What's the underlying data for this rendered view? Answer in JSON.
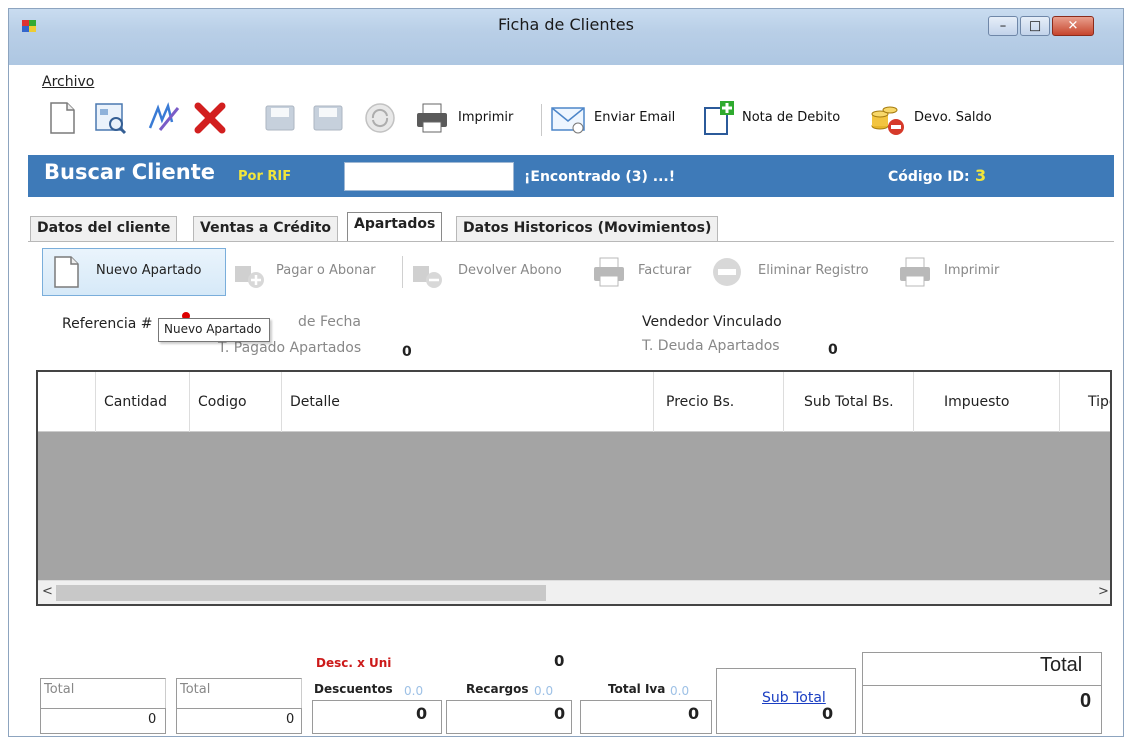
{
  "window": {
    "title": "Ficha de Clientes",
    "min_glyph": "–",
    "max_glyph": "□",
    "close_glyph": "✕"
  },
  "menu": {
    "archivo": "Archivo"
  },
  "toolbar": {
    "imprimir": "Imprimir",
    "enviar_email": "Enviar Email",
    "nota_debito": "Nota de Debito",
    "devo_saldo": "Devo. Saldo"
  },
  "search": {
    "title": "Buscar Cliente",
    "mode": "Por RIF",
    "input_value": "",
    "found": "¡Encontrado (3) ...!",
    "code_label": "Código ID:",
    "code_value": "3"
  },
  "tabs": [
    {
      "label": "Datos del cliente"
    },
    {
      "label": "Ventas a Crédito"
    },
    {
      "label": "Apartados"
    },
    {
      "label": "Datos Historicos (Movimientos)"
    }
  ],
  "subtoolbar": {
    "nuevo_apartado": "Nuevo Apartado",
    "pagar_abonar": "Pagar o Abonar",
    "devolver_abono": "Devolver Abono",
    "facturar": "Facturar",
    "eliminar_registro": "Eliminar Registro",
    "imprimir": "Imprimir"
  },
  "info": {
    "referencia": "Referencia #",
    "de_fecha": "de Fecha",
    "t_pagado": "T. Pagado Apartados",
    "t_pagado_val": "0",
    "vendedor": "Vendedor Vinculado",
    "t_deuda": "T. Deuda Apartados",
    "t_deuda_val": "0",
    "tooltip": "Nuevo Apartado"
  },
  "grid": {
    "columns": [
      "Cantidad",
      "Codigo",
      "Detalle",
      "Precio Bs.",
      "Sub Total Bs.",
      "Impuesto",
      "Tipo"
    ]
  },
  "totals": {
    "desc_x_uni": "Desc. x Uni",
    "desc_x_uni_val": "0",
    "total_label_1": "Total",
    "total_label_2": "Total",
    "descuentos": "Descuentos",
    "descuentos_hint": "0.0",
    "recargos": "Recargos",
    "recargos_hint": "0.0",
    "total_iva": "Total Iva",
    "total_iva_hint": "0.0",
    "sub_total": "Sub Total",
    "total_big": "Total",
    "total_big_val": "0",
    "val_1": "0",
    "val_2": "0",
    "val_desc": "0",
    "val_rec": "0",
    "val_iva": "0",
    "val_sub": "0"
  },
  "colors": {
    "search_bar": "#3e7ab8",
    "highlight_yellow": "#f3e63b",
    "red_label": "#cc1a1a",
    "link_blue": "#1a3ec2"
  }
}
